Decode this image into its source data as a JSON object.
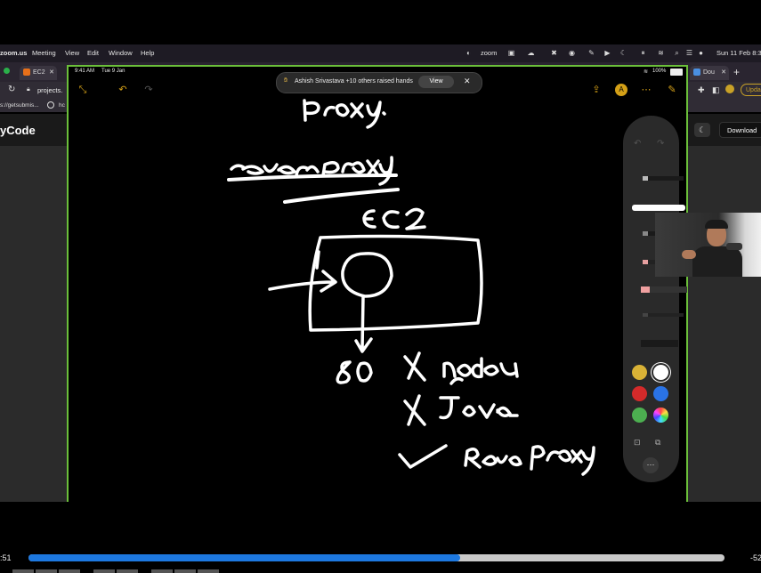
{
  "menubar": {
    "app": "zoom.us",
    "items": [
      "Meeting",
      "View",
      "Edit",
      "Window",
      "Help"
    ],
    "right_zoom": "zoom",
    "clock": "Sun 11 Feb 8:3"
  },
  "browser": {
    "tab1": "EC2",
    "tab_right": "Dou",
    "address": "projects.",
    "bookmark1": "s://getsubmis...",
    "bookmark2": "hc",
    "site_title": "yCode",
    "download": "Download",
    "update": "Upda"
  },
  "ipad": {
    "time": "9:41 AM",
    "date": "Tue 9 Jan",
    "battery": "100%",
    "banner_text": "Ashish Srivastava +10 others raised hands",
    "banner_view": "View"
  },
  "swatches": {
    "yellow": "#d9b236",
    "white": "#ffffff",
    "red": "#d42a2a",
    "blue": "#2a73e6",
    "green": "#4caf50"
  },
  "timeline": {
    "elapsed": ":51",
    "remaining": "-52",
    "progress": 0.62
  },
  "colors": {
    "accent_green": "#6bbf3a",
    "progress_blue": "#1d78e0",
    "zoom_yellow": "#d4a017"
  }
}
